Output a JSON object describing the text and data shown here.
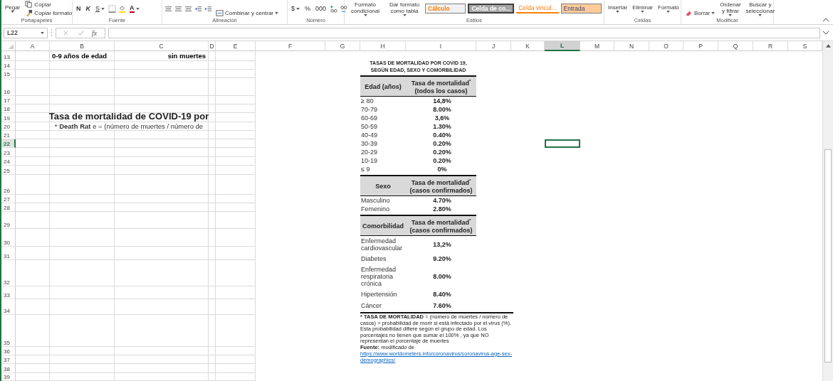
{
  "ribbon": {
    "groups": [
      {
        "label": "Portapapeles",
        "items": [
          {
            "kind": "large",
            "label": "Pegar",
            "dropdown": true
          },
          {
            "kind": "small",
            "label": "Copiar",
            "dropdown": false
          },
          {
            "kind": "small",
            "label": "Copiar formato",
            "dropdown": false
          }
        ]
      },
      {
        "label": "Fuente",
        "items": [
          {
            "kind": "format",
            "label": "N",
            "dropdown": false
          },
          {
            "kind": "format",
            "label": "K",
            "dropdown": false
          },
          {
            "kind": "format",
            "label": "S",
            "dropdown": true
          },
          {
            "kind": "tools"
          },
          {
            "kind": "format",
            "label": "A",
            "dropdown": true
          }
        ]
      },
      {
        "label": "Alineación",
        "items": [
          {
            "kind": "tools"
          },
          {
            "kind": "small",
            "label": "Combinar y centrar",
            "dropdown": true
          }
        ]
      },
      {
        "label": "Número",
        "items": [
          {
            "kind": "format",
            "label": "$",
            "dropdown": true
          },
          {
            "kind": "format",
            "label": "%",
            "dropdown": false
          },
          {
            "kind": "format",
            "label": "000",
            "dropdown": false
          },
          {
            "kind": "tools"
          }
        ]
      },
      {
        "label": "Estilos",
        "items": [
          {
            "kind": "large",
            "label": "Formato condicional",
            "dropdown": true
          },
          {
            "kind": "large",
            "label": "Dar formato como tabla",
            "dropdown": true
          },
          {
            "kind": "style",
            "label": "Cálculo",
            "dropdown": false
          },
          {
            "kind": "style",
            "label": "Celda de co...",
            "dropdown": false
          },
          {
            "kind": "style",
            "label": "Celda vincul...",
            "dropdown": false
          },
          {
            "kind": "style",
            "label": "Entrada",
            "dropdown": false
          }
        ]
      },
      {
        "label": "Celdas",
        "items": [
          {
            "kind": "large",
            "label": "Insertar",
            "dropdown": true
          },
          {
            "kind": "large",
            "label": "Eliminar",
            "dropdown": true
          },
          {
            "kind": "large",
            "label": "Formato",
            "dropdown": true
          }
        ]
      },
      {
        "label": "Modificar",
        "items": [
          {
            "kind": "small",
            "label": "Borrar",
            "dropdown": true
          },
          {
            "kind": "large",
            "label": "Ordenar y filtrar",
            "dropdown": true
          },
          {
            "kind": "large",
            "label": "Buscar y seleccionar",
            "dropdown": true
          }
        ]
      }
    ]
  },
  "formula_bar": {
    "name_box": "L22",
    "function_button": "fx"
  },
  "column_headers": [
    {
      "label": "A",
      "selected": false
    },
    {
      "label": "B",
      "selected": false
    },
    {
      "label": "C",
      "selected": false
    },
    {
      "label": "D",
      "selected": false
    },
    {
      "label": "E",
      "selected": false
    },
    {
      "label": "F",
      "selected": false
    },
    {
      "label": "G",
      "selected": false
    },
    {
      "label": "H",
      "selected": false
    },
    {
      "label": "I",
      "selected": false
    },
    {
      "label": "J",
      "selected": false
    },
    {
      "label": "K",
      "selected": false
    },
    {
      "label": "L",
      "selected": true
    },
    {
      "label": "M",
      "selected": false
    },
    {
      "label": "N",
      "selected": false
    },
    {
      "label": "O",
      "selected": false
    },
    {
      "label": "P",
      "selected": false
    },
    {
      "label": "Q",
      "selected": false
    },
    {
      "label": "R",
      "selected": false
    },
    {
      "label": "S",
      "selected": false
    }
  ],
  "rows": [
    {
      "number": "13",
      "selected": false,
      "column_b": {
        "kind": "label",
        "text": "0-9 años de edad"
      },
      "column_c": {
        "kind": "label",
        "text": "sin muertes"
      }
    },
    {
      "number": "14",
      "selected": false
    },
    {
      "number": "15",
      "selected": false
    },
    {
      "number": "16",
      "selected": false
    },
    {
      "number": "17",
      "selected": false
    },
    {
      "number": "18",
      "selected": false
    },
    {
      "number": "19",
      "selected": false,
      "column_b": {
        "kind": "title",
        "text": "Tasa de mortalidad de COVID-19 por"
      }
    },
    {
      "number": "20",
      "selected": false,
      "column_b": {
        "kind": "note",
        "mark": "*",
        "text": "**Death Rat** e = (número de muertes / número de"
      }
    },
    {
      "number": "21",
      "selected": false
    },
    {
      "number": "22",
      "selected": true
    },
    {
      "number": "23",
      "selected": false
    },
    {
      "number": "24",
      "selected": false
    },
    {
      "number": "25",
      "selected": false
    },
    {
      "number": "26",
      "selected": false
    },
    {
      "number": "27",
      "selected": false
    },
    {
      "number": "28",
      "selected": false
    },
    {
      "number": "29",
      "selected": false
    },
    {
      "number": "30",
      "selected": false
    },
    {
      "number": "31",
      "selected": false
    },
    {
      "number": "32",
      "selected": false
    },
    {
      "number": "33",
      "selected": false
    },
    {
      "number": "34",
      "selected": false
    },
    {
      "number": "35",
      "selected": false
    },
    {
      "number": "36",
      "selected": false
    },
    {
      "number": "37",
      "selected": false
    },
    {
      "number": "38",
      "selected": false
    },
    {
      "number": "39",
      "selected": false
    }
  ],
  "pasted_table": {
    "title_lines": [
      "TASAS DE MORTALIDAD POR COVID 19,",
      "SEGÚN EDAD, SEXO Y COMORBILIDAD"
    ],
    "sections": [
      {
        "label": "Edad (años)",
        "value_lines": [
          "Tasa de mortalidad",
          "(todos los casos)"
        ],
        "mark": "*",
        "rows": [
          {
            "label": "≥ 80",
            "value": "14,8%"
          },
          {
            "label": "70-79",
            "value": "8.00%"
          },
          {
            "label": "60-69",
            "value": "3,6%"
          },
          {
            "label": "50-59",
            "value": "1.30%"
          },
          {
            "label": "40-49",
            "value": "0.40%"
          },
          {
            "label": "30-39",
            "value": "0.20%"
          },
          {
            "label": "20-29",
            "value": "0.20%"
          },
          {
            "label": "10-19",
            "value": "0.20%"
          },
          {
            "label": "≤ 9",
            "value": "0%"
          }
        ]
      },
      {
        "label": "Sexo",
        "value_lines": [
          "Tasa de mortalidad",
          "(casos confirmados)"
        ],
        "mark": "*",
        "rows": [
          {
            "label": "Masculino",
            "value": "4.70%"
          },
          {
            "label": "Femenino",
            "value": "2.80%"
          }
        ]
      },
      {
        "label": "Comorbilidad",
        "value_lines": [
          "Tasa de mortalidad",
          "(casos confirmados)"
        ],
        "mark": "*",
        "rows": [
          {
            "label": "Enfermedad cardiovascular",
            "value": "13,2%"
          },
          {
            "label": "Diabetes",
            "value": "9.20%"
          },
          {
            "label": "Enfermedad respiratoria crónica",
            "value": "8.00%"
          },
          {
            "label": "Hipertensión",
            "value": "8.40%"
          },
          {
            "label": "Cáncer",
            "value": "7.60%"
          }
        ]
      }
    ],
    "footnote": {
      "mark": "*",
      "text": "**TASA DE MORTALIDAD** = (número de muertes / número de casos) = probabilidad de morir si está infectado por el virus (%). Esta probabilidad difiere según el grupo de edad. Los porcentajes no tienen que sumar el 100% , ya que NO representan el porcentaje de muertes"
    },
    "source": "**Fuente:** modificado de",
    "link": "https://www.worldometers.info/coronavirus/coronavirus-age-sex-demographics/"
  }
}
